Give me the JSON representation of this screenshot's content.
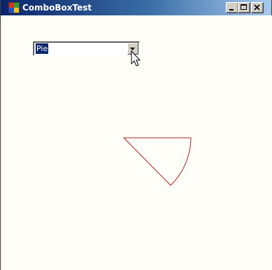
{
  "window": {
    "title": "ComboBoxTest"
  },
  "combo": {
    "selected": "Pie"
  },
  "colors": {
    "pie_stroke": "#b22222",
    "title_gradient_start": "#0a246a",
    "title_gradient_end": "#a6caf0"
  },
  "icons": {
    "app": "app-icon",
    "minimize": "minimize-icon",
    "maximize": "maximize-icon",
    "close": "close-icon",
    "dropdown": "chevron-down-icon",
    "cursor": "mouse-cursor-icon"
  }
}
